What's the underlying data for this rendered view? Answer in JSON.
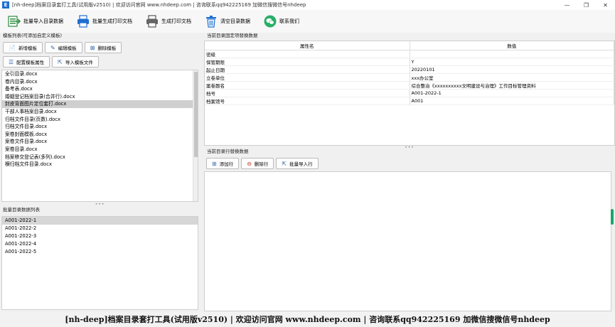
{
  "window": {
    "title": "[nh-deep]档案目录套打工具(试用版v2510) | 欢迎访问官网 www.nhdeep.com | 咨询联系qq942225169 加微信搜微信号nhdeep",
    "app_icon_letter": "E",
    "minimize": "—",
    "maximize": "❐",
    "close": "✕"
  },
  "toolbar": {
    "import_label": "批量导入目录数据",
    "batch_print_label": "批量生成打印文档",
    "print_label": "生成打印文档",
    "clear_label": "清空目录数据",
    "contact_label": "联系我们"
  },
  "templates": {
    "section_title": "模板列表(可添加自定义模板)",
    "new_label": "新增模板",
    "edit_label": "编辑模板",
    "delete_label": "删除模板",
    "config_label": "配置模板属性",
    "import_label": "导入模板文件",
    "items": [
      "全引目录.docx",
      "卷内目录.docx",
      "备考表.docx",
      "婚姻登记档案目录(合并行).docx",
      "封皮背面图片定位套打.docx",
      "干部人事档案目录.docx",
      "归档文件目录(页数).docx",
      "归档文件目录.docx",
      "案卷封面模板.docx",
      "案卷文件目录.docx",
      "案卷目录.docx",
      "档案移交登记表(多列).docx",
      "横归档文件目录.docx"
    ],
    "selected_index": 4
  },
  "batch": {
    "section_title": "批量目录数据列表",
    "items": [
      "A001-2022-1",
      "A001-2022-2",
      "A001-2022-3",
      "A001-2022-4",
      "A001-2022-5"
    ],
    "selected_index": 0
  },
  "attributes": {
    "section_title": "当前目录固定项替换数据",
    "col_name": "属性名",
    "col_value": "数值",
    "rows": [
      {
        "name": "密级",
        "value": ""
      },
      {
        "name": "保管期限",
        "value": "Y"
      },
      {
        "name": "起止日期",
        "value": "20220101"
      },
      {
        "name": "立卷单位",
        "value": "xxx办公室"
      },
      {
        "name": "案卷题名",
        "value": "综合整治《xxxxxxxxxx文明建设与治理》工作目标管理资料"
      },
      {
        "name": "档号",
        "value": "A001-2022-1"
      },
      {
        "name": "档案馆号",
        "value": "A001"
      }
    ]
  },
  "rows_section": {
    "section_title": "当前目录行替换数据",
    "add_label": "添加行",
    "delete_label": "删除行",
    "import_label": "批量导入行"
  },
  "footer": {
    "text": "[nh-deep]档案目录套打工具(试用版v2510) | 欢迎访问官网 www.nhdeep.com | 咨询联系qq942225169 加微信搜微信号nhdeep"
  },
  "colors": {
    "selection": "#cfcfcf",
    "accent": "#1e6fd0",
    "wechat_green": "#2aae67",
    "scroll_indicator": "#19a868"
  }
}
